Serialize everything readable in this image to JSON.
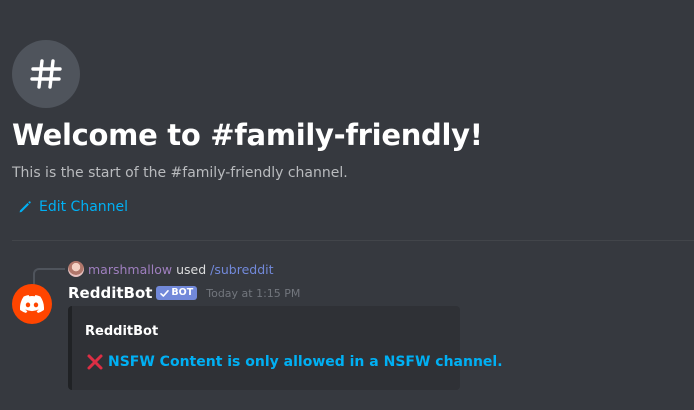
{
  "welcome": {
    "icon": "hashtag-icon",
    "title": "Welcome to #family-friendly!",
    "subtitle": "This is the start of the #family-friendly channel.",
    "edit_icon": "pencil-icon",
    "edit_label": "Edit Channel"
  },
  "reply": {
    "user": "marshmallow",
    "verb": "used",
    "command": "/subreddit"
  },
  "message": {
    "author": "RedditBot",
    "bot_tag": "BOT",
    "timestamp": "Today at 1:15 PM",
    "avatar_icon": "discord-logo-icon",
    "avatar_color": "#ff4500",
    "embed": {
      "title": "RedditBot",
      "icon": "red-x-icon",
      "description": "NSFW Content is only allowed in a NSFW channel."
    }
  },
  "colors": {
    "background": "#36393f",
    "link": "#00b0f4",
    "bot_tag": "#7289da",
    "embed_bg": "#2f3136"
  }
}
